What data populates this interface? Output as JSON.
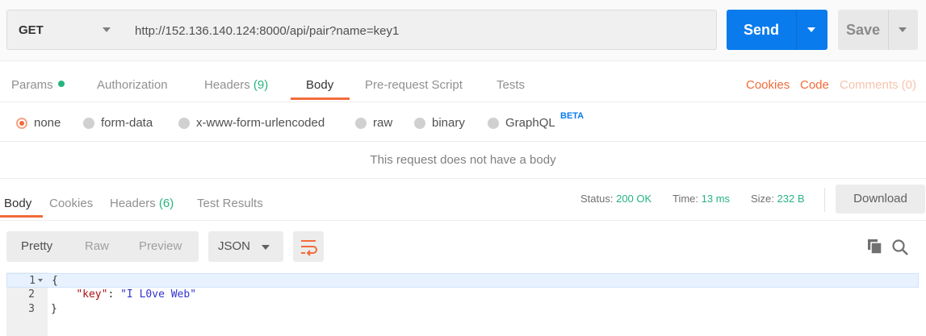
{
  "request": {
    "method": "GET",
    "url": "http://152.136.140.124:8000/api/pair?name=key1",
    "send_label": "Send",
    "save_label": "Save"
  },
  "request_tabs": {
    "params": "Params",
    "authorization": "Authorization",
    "headers": "Headers",
    "headers_count": "(9)",
    "body": "Body",
    "prerequest": "Pre-request Script",
    "tests": "Tests",
    "cookies": "Cookies",
    "code": "Code",
    "comments": "Comments (0)"
  },
  "body_types": {
    "none": "none",
    "form_data": "form-data",
    "urlencoded": "x-www-form-urlencoded",
    "raw": "raw",
    "binary": "binary",
    "graphql": "GraphQL",
    "beta": "BETA",
    "selected": "none"
  },
  "no_body_message": "This request does not have a body",
  "response_tabs": {
    "body": "Body",
    "cookies": "Cookies",
    "headers": "Headers",
    "headers_count": "(6)",
    "test_results": "Test Results"
  },
  "status": {
    "status_label": "Status:",
    "status_value": "200 OK",
    "time_label": "Time:",
    "time_value": "13 ms",
    "size_label": "Size:",
    "size_value": "232 B",
    "download_label": "Download"
  },
  "response_view": {
    "pretty": "Pretty",
    "raw": "Raw",
    "preview": "Preview",
    "format": "JSON"
  },
  "response_body": {
    "line_numbers": [
      "1",
      "2",
      "3"
    ],
    "open_brace": "{",
    "key": "\"key\"",
    "colon": ": ",
    "value": "\"I L0ve Web\"",
    "close_brace": "}"
  },
  "colors": {
    "accent": "#f26b3a",
    "send_blue": "#097bed",
    "success_green": "#26b47f"
  }
}
